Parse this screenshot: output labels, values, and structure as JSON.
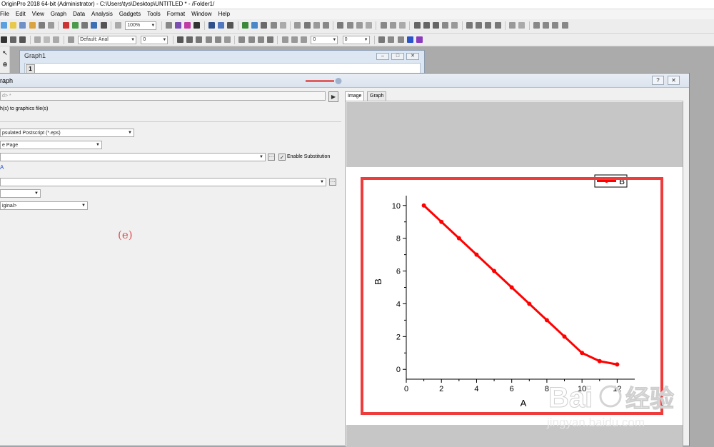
{
  "window": {
    "title": "OriginPro 2018 64-bit (Administrator) - C:\\Users\\tys\\Desktop\\UNTITLED * - /Folder1/"
  },
  "menubar": [
    "File",
    "Edit",
    "View",
    "Graph",
    "Data",
    "Analysis",
    "Gadgets",
    "Tools",
    "Format",
    "Window",
    "Help"
  ],
  "toolbar": {
    "zoom_value": "100%",
    "font_value": "Default: Arial",
    "fontsize_value": "0",
    "linewidth_value": "0",
    "linestyle_value": "0"
  },
  "graph_window": {
    "title": "Graph1",
    "layer_label": "1"
  },
  "dialog": {
    "title": "raph",
    "theme_value": "d> *",
    "subtitle": "h(s) to graphics file(s)",
    "image_type": "psulated Postscript (*.eps)",
    "export_what": "e Page",
    "file_name": "",
    "enable_substitution_label": "Enable Substitution",
    "enable_substitution_checked": true,
    "marker": "A",
    "path": "",
    "small_combo": "",
    "size_value": "iginal>",
    "figure_label": "(e)",
    "tabs": [
      "Image",
      "Graph"
    ],
    "active_tab": "Image"
  },
  "watermark": {
    "brand": "Bai",
    "brand_cn": "经验",
    "url": "jingyan.baidu.com"
  },
  "colors": {
    "highlight_box": "#ee3b3b",
    "series": "#ff0000",
    "figure_label": "#e05050"
  },
  "chart_data": {
    "type": "line",
    "xlabel": "A",
    "ylabel": "B",
    "xlim": [
      0,
      13
    ],
    "ylim": [
      -0.6,
      10.6
    ],
    "xticks": [
      0,
      2,
      4,
      6,
      8,
      10,
      12
    ],
    "yticks": [
      0,
      2,
      4,
      6,
      8,
      10
    ],
    "legend_position": "top-right",
    "series": [
      {
        "name": "B",
        "x": [
          1,
          2,
          3,
          4,
          5,
          6,
          7,
          8,
          9,
          10,
          11,
          12
        ],
        "y": [
          10,
          9,
          8,
          7,
          6,
          5,
          4,
          3,
          2,
          1,
          0.5,
          0.3
        ]
      }
    ]
  }
}
